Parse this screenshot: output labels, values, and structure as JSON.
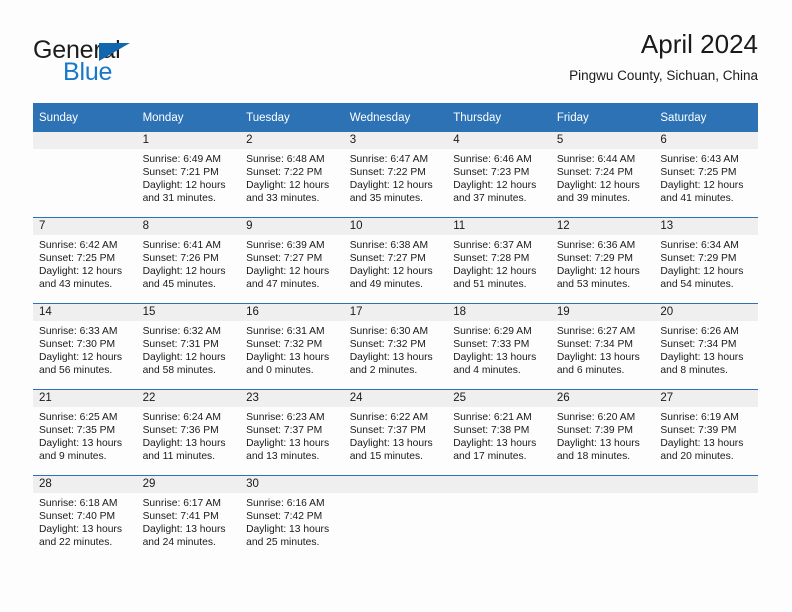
{
  "brand": {
    "word_one": "General",
    "word_two": "Blue",
    "accent_color": "#1878c8",
    "triangle_color": "#1266ad",
    "logo_icon": "triangle-icon"
  },
  "header": {
    "title": "April 2024",
    "subtitle": "Pingwu County, Sichuan, China"
  },
  "theme": {
    "header_blue": "#2c72b4",
    "daynum_band": "#efefef",
    "page_background": "#fdfdfd",
    "text": "#1a1a1a"
  },
  "weekday_headers": [
    "Sunday",
    "Monday",
    "Tuesday",
    "Wednesday",
    "Thursday",
    "Friday",
    "Saturday"
  ],
  "weeks": [
    [
      {
        "day": "",
        "empty": true,
        "sunrise": "",
        "sunset": "",
        "daylight_line1": "",
        "daylight_line2": ""
      },
      {
        "day": "1",
        "empty": false,
        "sunrise": "Sunrise: 6:49 AM",
        "sunset": "Sunset: 7:21 PM",
        "daylight_line1": "Daylight: 12 hours",
        "daylight_line2": "and 31 minutes."
      },
      {
        "day": "2",
        "empty": false,
        "sunrise": "Sunrise: 6:48 AM",
        "sunset": "Sunset: 7:22 PM",
        "daylight_line1": "Daylight: 12 hours",
        "daylight_line2": "and 33 minutes."
      },
      {
        "day": "3",
        "empty": false,
        "sunrise": "Sunrise: 6:47 AM",
        "sunset": "Sunset: 7:22 PM",
        "daylight_line1": "Daylight: 12 hours",
        "daylight_line2": "and 35 minutes."
      },
      {
        "day": "4",
        "empty": false,
        "sunrise": "Sunrise: 6:46 AM",
        "sunset": "Sunset: 7:23 PM",
        "daylight_line1": "Daylight: 12 hours",
        "daylight_line2": "and 37 minutes."
      },
      {
        "day": "5",
        "empty": false,
        "sunrise": "Sunrise: 6:44 AM",
        "sunset": "Sunset: 7:24 PM",
        "daylight_line1": "Daylight: 12 hours",
        "daylight_line2": "and 39 minutes."
      },
      {
        "day": "6",
        "empty": false,
        "sunrise": "Sunrise: 6:43 AM",
        "sunset": "Sunset: 7:25 PM",
        "daylight_line1": "Daylight: 12 hours",
        "daylight_line2": "and 41 minutes."
      }
    ],
    [
      {
        "day": "7",
        "empty": false,
        "sunrise": "Sunrise: 6:42 AM",
        "sunset": "Sunset: 7:25 PM",
        "daylight_line1": "Daylight: 12 hours",
        "daylight_line2": "and 43 minutes."
      },
      {
        "day": "8",
        "empty": false,
        "sunrise": "Sunrise: 6:41 AM",
        "sunset": "Sunset: 7:26 PM",
        "daylight_line1": "Daylight: 12 hours",
        "daylight_line2": "and 45 minutes."
      },
      {
        "day": "9",
        "empty": false,
        "sunrise": "Sunrise: 6:39 AM",
        "sunset": "Sunset: 7:27 PM",
        "daylight_line1": "Daylight: 12 hours",
        "daylight_line2": "and 47 minutes."
      },
      {
        "day": "10",
        "empty": false,
        "sunrise": "Sunrise: 6:38 AM",
        "sunset": "Sunset: 7:27 PM",
        "daylight_line1": "Daylight: 12 hours",
        "daylight_line2": "and 49 minutes."
      },
      {
        "day": "11",
        "empty": false,
        "sunrise": "Sunrise: 6:37 AM",
        "sunset": "Sunset: 7:28 PM",
        "daylight_line1": "Daylight: 12 hours",
        "daylight_line2": "and 51 minutes."
      },
      {
        "day": "12",
        "empty": false,
        "sunrise": "Sunrise: 6:36 AM",
        "sunset": "Sunset: 7:29 PM",
        "daylight_line1": "Daylight: 12 hours",
        "daylight_line2": "and 53 minutes."
      },
      {
        "day": "13",
        "empty": false,
        "sunrise": "Sunrise: 6:34 AM",
        "sunset": "Sunset: 7:29 PM",
        "daylight_line1": "Daylight: 12 hours",
        "daylight_line2": "and 54 minutes."
      }
    ],
    [
      {
        "day": "14",
        "empty": false,
        "sunrise": "Sunrise: 6:33 AM",
        "sunset": "Sunset: 7:30 PM",
        "daylight_line1": "Daylight: 12 hours",
        "daylight_line2": "and 56 minutes."
      },
      {
        "day": "15",
        "empty": false,
        "sunrise": "Sunrise: 6:32 AM",
        "sunset": "Sunset: 7:31 PM",
        "daylight_line1": "Daylight: 12 hours",
        "daylight_line2": "and 58 minutes."
      },
      {
        "day": "16",
        "empty": false,
        "sunrise": "Sunrise: 6:31 AM",
        "sunset": "Sunset: 7:32 PM",
        "daylight_line1": "Daylight: 13 hours",
        "daylight_line2": "and 0 minutes."
      },
      {
        "day": "17",
        "empty": false,
        "sunrise": "Sunrise: 6:30 AM",
        "sunset": "Sunset: 7:32 PM",
        "daylight_line1": "Daylight: 13 hours",
        "daylight_line2": "and 2 minutes."
      },
      {
        "day": "18",
        "empty": false,
        "sunrise": "Sunrise: 6:29 AM",
        "sunset": "Sunset: 7:33 PM",
        "daylight_line1": "Daylight: 13 hours",
        "daylight_line2": "and 4 minutes."
      },
      {
        "day": "19",
        "empty": false,
        "sunrise": "Sunrise: 6:27 AM",
        "sunset": "Sunset: 7:34 PM",
        "daylight_line1": "Daylight: 13 hours",
        "daylight_line2": "and 6 minutes."
      },
      {
        "day": "20",
        "empty": false,
        "sunrise": "Sunrise: 6:26 AM",
        "sunset": "Sunset: 7:34 PM",
        "daylight_line1": "Daylight: 13 hours",
        "daylight_line2": "and 8 minutes."
      }
    ],
    [
      {
        "day": "21",
        "empty": false,
        "sunrise": "Sunrise: 6:25 AM",
        "sunset": "Sunset: 7:35 PM",
        "daylight_line1": "Daylight: 13 hours",
        "daylight_line2": "and 9 minutes."
      },
      {
        "day": "22",
        "empty": false,
        "sunrise": "Sunrise: 6:24 AM",
        "sunset": "Sunset: 7:36 PM",
        "daylight_line1": "Daylight: 13 hours",
        "daylight_line2": "and 11 minutes."
      },
      {
        "day": "23",
        "empty": false,
        "sunrise": "Sunrise: 6:23 AM",
        "sunset": "Sunset: 7:37 PM",
        "daylight_line1": "Daylight: 13 hours",
        "daylight_line2": "and 13 minutes."
      },
      {
        "day": "24",
        "empty": false,
        "sunrise": "Sunrise: 6:22 AM",
        "sunset": "Sunset: 7:37 PM",
        "daylight_line1": "Daylight: 13 hours",
        "daylight_line2": "and 15 minutes."
      },
      {
        "day": "25",
        "empty": false,
        "sunrise": "Sunrise: 6:21 AM",
        "sunset": "Sunset: 7:38 PM",
        "daylight_line1": "Daylight: 13 hours",
        "daylight_line2": "and 17 minutes."
      },
      {
        "day": "26",
        "empty": false,
        "sunrise": "Sunrise: 6:20 AM",
        "sunset": "Sunset: 7:39 PM",
        "daylight_line1": "Daylight: 13 hours",
        "daylight_line2": "and 18 minutes."
      },
      {
        "day": "27",
        "empty": false,
        "sunrise": "Sunrise: 6:19 AM",
        "sunset": "Sunset: 7:39 PM",
        "daylight_line1": "Daylight: 13 hours",
        "daylight_line2": "and 20 minutes."
      }
    ],
    [
      {
        "day": "28",
        "empty": false,
        "sunrise": "Sunrise: 6:18 AM",
        "sunset": "Sunset: 7:40 PM",
        "daylight_line1": "Daylight: 13 hours",
        "daylight_line2": "and 22 minutes."
      },
      {
        "day": "29",
        "empty": false,
        "sunrise": "Sunrise: 6:17 AM",
        "sunset": "Sunset: 7:41 PM",
        "daylight_line1": "Daylight: 13 hours",
        "daylight_line2": "and 24 minutes."
      },
      {
        "day": "30",
        "empty": false,
        "sunrise": "Sunrise: 6:16 AM",
        "sunset": "Sunset: 7:42 PM",
        "daylight_line1": "Daylight: 13 hours",
        "daylight_line2": "and 25 minutes."
      },
      {
        "day": "",
        "empty": true,
        "sunrise": "",
        "sunset": "",
        "daylight_line1": "",
        "daylight_line2": ""
      },
      {
        "day": "",
        "empty": true,
        "sunrise": "",
        "sunset": "",
        "daylight_line1": "",
        "daylight_line2": ""
      },
      {
        "day": "",
        "empty": true,
        "sunrise": "",
        "sunset": "",
        "daylight_line1": "",
        "daylight_line2": ""
      },
      {
        "day": "",
        "empty": true,
        "sunrise": "",
        "sunset": "",
        "daylight_line1": "",
        "daylight_line2": ""
      }
    ]
  ]
}
